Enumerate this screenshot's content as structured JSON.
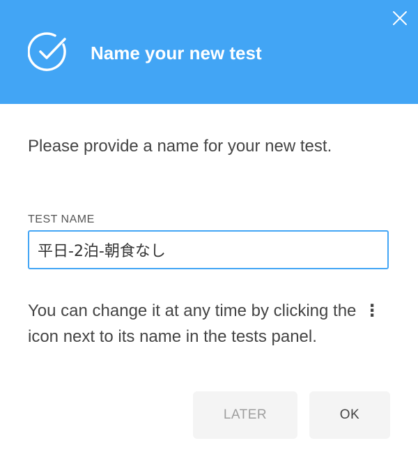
{
  "dialog": {
    "title": "Name your new test",
    "title_icon": "check-circle-icon",
    "close_icon": "close-icon",
    "intro": "Please provide a name for your new test.",
    "field_label": "TEST NAME",
    "field_value": "平日-2泊-朝食なし",
    "help_before": "You can change it at any time by clicking the",
    "help_icon": "⋮",
    "help_after": "icon next to its name in the tests panel.",
    "later_label": "LATER",
    "ok_label": "OK"
  },
  "colors": {
    "header": "#42a5f5",
    "input_border": "#42a5f5",
    "button_bg": "#f4f4f4"
  }
}
